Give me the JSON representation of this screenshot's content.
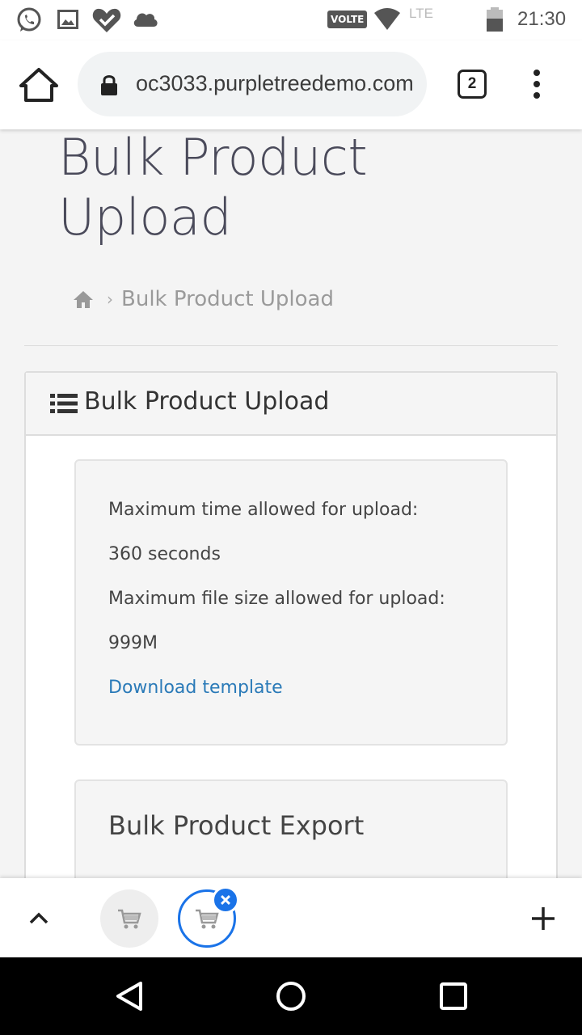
{
  "status_bar": {
    "volte": "VOLTE",
    "network": "LTE",
    "time": "21:30",
    "icons": [
      "whatsapp-icon",
      "gallery-icon",
      "heart-check-icon",
      "cloud-icon",
      "wifi-icon",
      "battery-icon"
    ]
  },
  "browser": {
    "url": "oc3033.purpletreedemo.com",
    "tab_count": "2"
  },
  "page": {
    "title": "Bulk Product Upload",
    "breadcrumb": {
      "separator": "›",
      "current": "Bulk Product Upload"
    },
    "panel": {
      "title": "Bulk Product Upload",
      "info": {
        "time_label": "Maximum time allowed for upload:",
        "time_value": "360 seconds",
        "size_label": "Maximum file size allowed for upload:",
        "size_value": "999M",
        "download_link": "Download template"
      },
      "export_title": "Bulk Product Export"
    }
  },
  "colors": {
    "link": "#2a7ab8",
    "active_tab": "#1a73e8"
  }
}
